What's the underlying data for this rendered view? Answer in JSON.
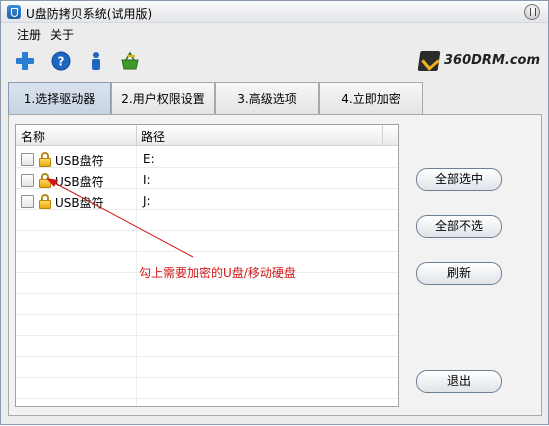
{
  "window": {
    "title": "U盘防拷贝系统(试用版)"
  },
  "menu": [
    {
      "label": "注册"
    },
    {
      "label": "关于"
    }
  ],
  "toolbar": {
    "icons": [
      "add-icon",
      "help-icon",
      "info-icon",
      "basket-icon"
    ]
  },
  "brand": {
    "text": "360DRM.com"
  },
  "tabs": [
    {
      "label": "1.选择驱动器",
      "active": true
    },
    {
      "label": "2.用户权限设置",
      "active": false
    },
    {
      "label": "3.高级选项",
      "active": false
    },
    {
      "label": "4.立即加密",
      "active": false
    }
  ],
  "list": {
    "columns": [
      {
        "label": "名称"
      },
      {
        "label": "路径"
      }
    ],
    "rows": [
      {
        "name": "USB盘符",
        "path": "E:",
        "checked": false
      },
      {
        "name": "USB盘符",
        "path": "I:",
        "checked": false
      },
      {
        "name": "USB盘符",
        "path": "J:",
        "checked": false
      }
    ]
  },
  "buttons": {
    "select_all": "全部选中",
    "select_none": "全部不选",
    "refresh": "刷新",
    "exit": "退出"
  },
  "annotation": {
    "text": "勾上需要加密的U盘/移动硬盘",
    "color": "#d11818"
  }
}
